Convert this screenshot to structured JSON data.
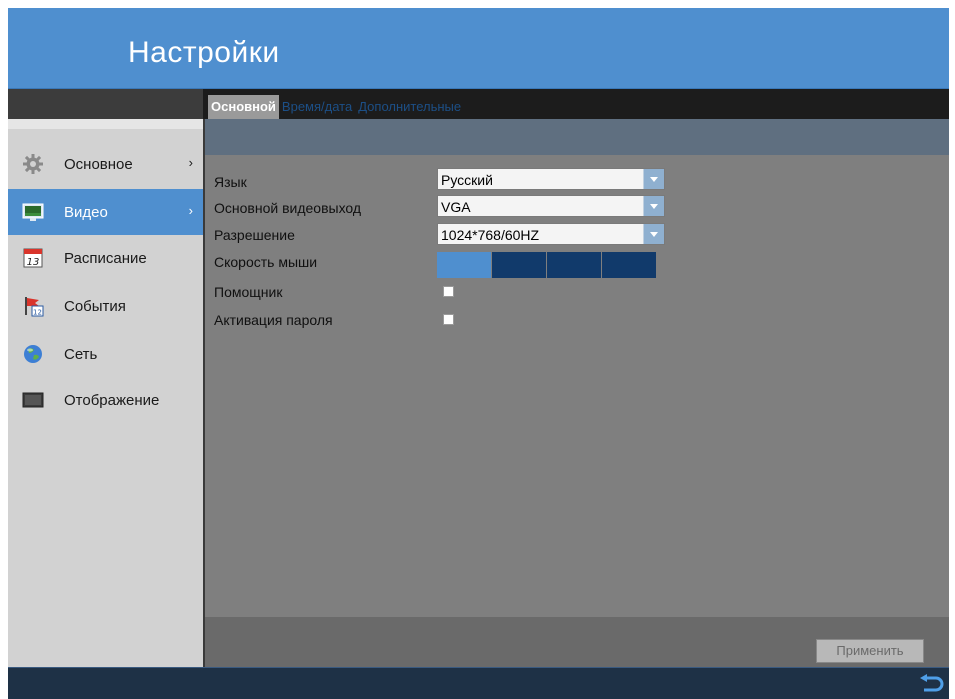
{
  "header": {
    "title": "Настройки"
  },
  "tabs": [
    {
      "label": "Основной",
      "active": true
    },
    {
      "label": "Время/дата",
      "active": false
    },
    {
      "label": "Дополнительные",
      "active": false
    }
  ],
  "sidebar": {
    "items": [
      {
        "label": "Основное",
        "icon": "gear-icon",
        "arrow": "›"
      },
      {
        "label": "Видео",
        "icon": "monitor-icon",
        "arrow": "›",
        "active": true
      },
      {
        "label": "Расписание",
        "icon": "calendar-icon",
        "calendar_day": "13"
      },
      {
        "label": "События",
        "icon": "event-flag-icon",
        "calendar_day": "12"
      },
      {
        "label": "Сеть",
        "icon": "globe-icon"
      },
      {
        "label": "Отображение",
        "icon": "display-icon"
      }
    ]
  },
  "form": {
    "language": {
      "label": "Язык",
      "value": "Русский"
    },
    "video_output": {
      "label": "Основной видеовыход",
      "value": "VGA"
    },
    "resolution": {
      "label": "Разрешение",
      "value": "1024*768/60HZ"
    },
    "mouse_speed": {
      "label": "Скорость мыши",
      "level": 1,
      "max": 4
    },
    "wizard": {
      "label": "Помощник",
      "checked": false
    },
    "password": {
      "label": "Активация пароля",
      "checked": false
    }
  },
  "footer": {
    "apply_label": "Применить"
  },
  "colors": {
    "accent": "#4f8fcf",
    "slider_off": "#113a6b",
    "bottom_bar": "#1e3146"
  }
}
